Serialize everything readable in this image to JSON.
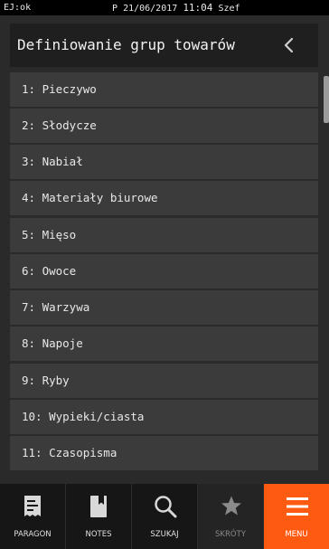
{
  "status_bar": {
    "left": "EJ:ok",
    "mode": "P",
    "date": "21/06/2017",
    "time": "11:04",
    "user": "Szef"
  },
  "header": {
    "title": "Definiowanie grup towarów",
    "back_icon": "chevron-left-icon"
  },
  "groups": [
    "1: Pieczywo",
    "2: Słodycze",
    "3: Nabiał",
    "4: Materiały biurowe",
    "5: Mięso",
    "6: Owoce",
    "7: Warzywa",
    "8: Napoje",
    "9: Ryby",
    "10: Wypieki/ciasta",
    "11: Czasopisma"
  ],
  "bottom_nav": [
    {
      "label": "PARAGON",
      "icon": "receipt-icon",
      "state": "normal"
    },
    {
      "label": "NOTES",
      "icon": "notebook-icon",
      "state": "normal"
    },
    {
      "label": "SZUKAJ",
      "icon": "search-icon",
      "state": "normal"
    },
    {
      "label": "SKRÓTY",
      "icon": "star-icon",
      "state": "disabled"
    },
    {
      "label": "MENU",
      "icon": "menu-icon",
      "state": "active"
    }
  ],
  "colors": {
    "background": "#2a2a2a",
    "item_background": "#3b3b3b",
    "header_background": "#1f1f1f",
    "accent": "#ff5a12"
  }
}
